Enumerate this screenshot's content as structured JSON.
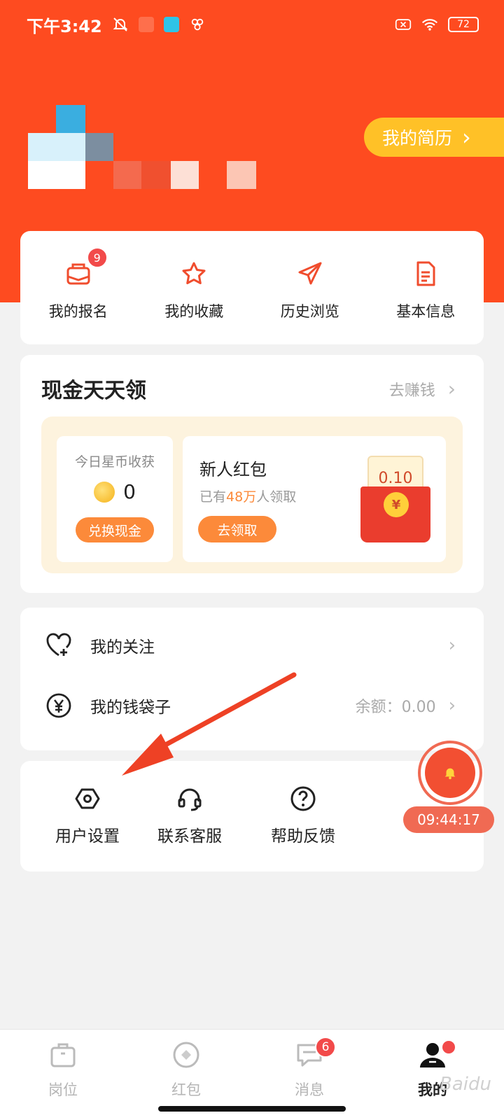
{
  "status_bar": {
    "time": "下午3:42",
    "battery": "72"
  },
  "header": {
    "resume_label": "我的简历",
    "resume_chevron": "›"
  },
  "quick_actions": [
    {
      "label": "我的报名",
      "icon": "envelope-icon",
      "badge": "9"
    },
    {
      "label": "我的收藏",
      "icon": "star-icon"
    },
    {
      "label": "历史浏览",
      "icon": "paper-plane-icon"
    },
    {
      "label": "基本信息",
      "icon": "document-icon"
    }
  ],
  "cash": {
    "title": "现金天天领",
    "earn_link": "去赚钱",
    "coins": {
      "title": "今日星币收获",
      "value": "0",
      "button": "兑换现金"
    },
    "redpack": {
      "title": "新人红包",
      "sub_prefix": "已有",
      "sub_highlight": "48万",
      "sub_suffix": "人领取",
      "button": "去领取",
      "amount": "0.10",
      "currency": "¥"
    }
  },
  "list": [
    {
      "label": "我的关注",
      "icon": "heart-plus-icon",
      "value": ""
    },
    {
      "label": "我的钱袋子",
      "icon": "yuan-circle-icon",
      "value": "余额：0.00"
    }
  ],
  "tools": [
    {
      "label": "用户设置",
      "icon": "hexagon-settings-icon"
    },
    {
      "label": "联系客服",
      "icon": "headset-icon"
    },
    {
      "label": "帮助反馈",
      "icon": "help-circle-icon"
    }
  ],
  "floating": {
    "timer": "09:44:17"
  },
  "tabbar": [
    {
      "label": "岗位",
      "icon": "briefcase-icon",
      "active": false
    },
    {
      "label": "红包",
      "icon": "coin-icon",
      "active": false
    },
    {
      "label": "消息",
      "icon": "message-icon",
      "active": false,
      "badge": "6"
    },
    {
      "label": "我的",
      "icon": "person-icon",
      "active": true
    }
  ],
  "watermark": "Baidu"
}
